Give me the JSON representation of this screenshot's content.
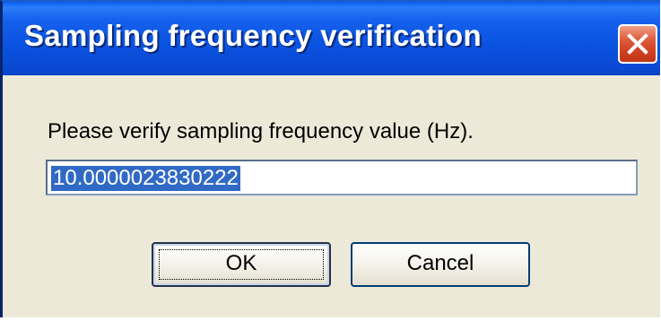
{
  "window": {
    "title": "Sampling frequency verification"
  },
  "dialog": {
    "prompt": "Please verify sampling frequency value (Hz).",
    "input_value": "10.0000023830222"
  },
  "buttons": {
    "ok_label": "OK",
    "cancel_label": "Cancel"
  },
  "icons": {
    "close": "close-icon"
  },
  "colors": {
    "titlebar": "#0a52e0",
    "close_button": "#d04020",
    "dialog_background": "#ece9d8",
    "selection": "#316ac5"
  }
}
